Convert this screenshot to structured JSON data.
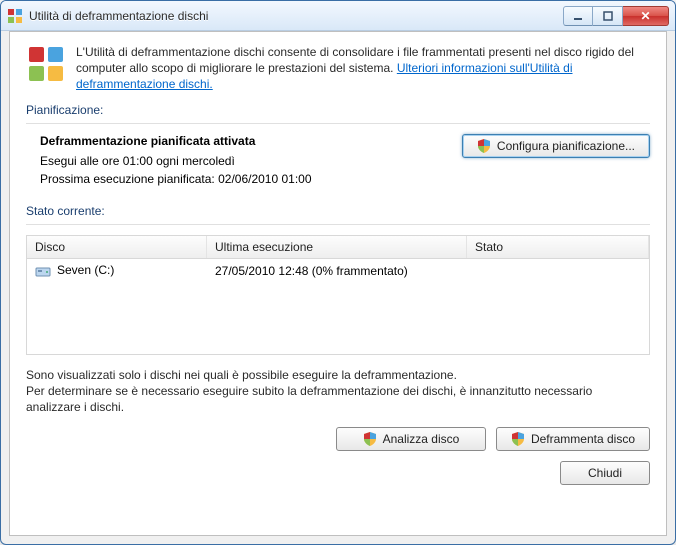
{
  "window": {
    "title": "Utilità di deframmentazione dischi"
  },
  "info": {
    "text_prefix": "L'Utilità di deframmentazione dischi consente di consolidare i file frammentati presenti nel disco rigido del computer allo scopo di migliorare le prestazioni del sistema. ",
    "link_text": "Ulteriori informazioni sull'Utilità di deframmentazione dischi."
  },
  "schedule": {
    "section_label": "Pianificazione:",
    "heading": "Deframmentazione pianificata attivata",
    "run_line": "Esegui alle ore 01:00 ogni mercoledì",
    "next_line": "Prossima esecuzione pianificata: 02/06/2010 01:00",
    "configure_btn": "Configura pianificazione..."
  },
  "state": {
    "section_label": "Stato corrente:",
    "columns": {
      "disk": "Disco",
      "last": "Ultima esecuzione",
      "status": "Stato"
    },
    "rows": [
      {
        "name": "Seven (C:)",
        "last": "27/05/2010 12:48 (0% frammentato)",
        "status": ""
      }
    ]
  },
  "note": {
    "line1": "Sono visualizzati solo i dischi nei quali è possibile eseguire la deframmentazione.",
    "line2": "Per determinare se è necessario eseguire subito la deframmentazione dei dischi, è innanzitutto necessario analizzare i dischi."
  },
  "buttons": {
    "analyze": "Analizza disco",
    "defrag": "Deframmenta disco",
    "close": "Chiudi"
  }
}
